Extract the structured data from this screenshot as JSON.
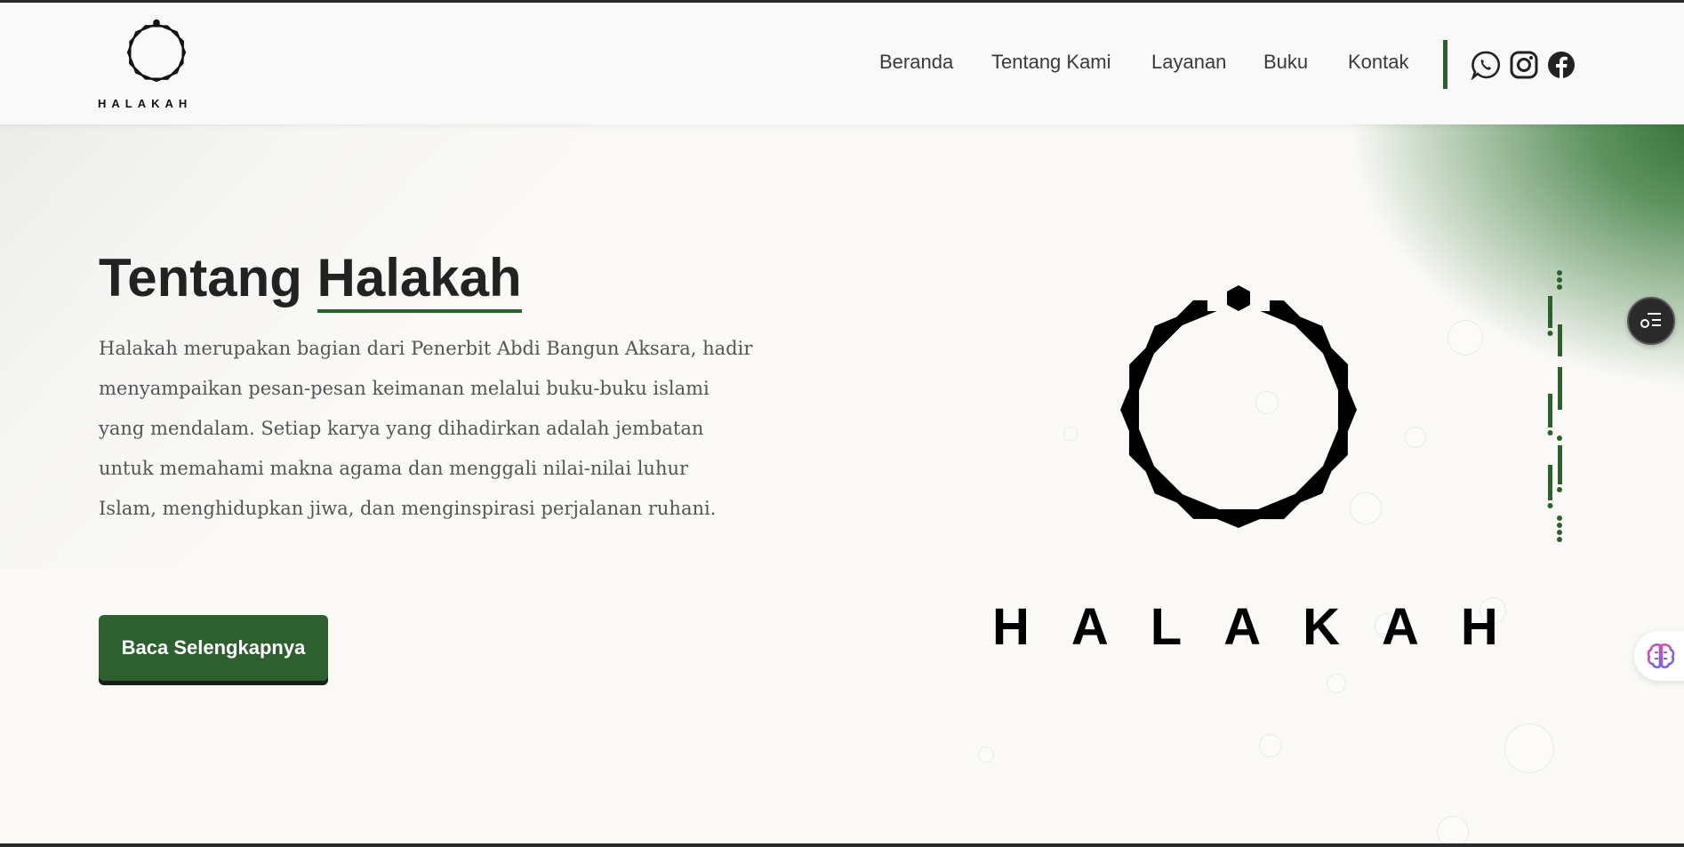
{
  "brand": {
    "name": "HALAKAH",
    "icon": "halakah-logo"
  },
  "nav": {
    "items": [
      {
        "label": "Beranda"
      },
      {
        "label": "Tentang Kami"
      },
      {
        "label": "Layanan"
      },
      {
        "label": "Buku"
      },
      {
        "label": "Kontak"
      }
    ],
    "social": [
      {
        "icon": "whatsapp-icon"
      },
      {
        "icon": "instagram-icon"
      },
      {
        "icon": "facebook-icon"
      }
    ]
  },
  "about": {
    "title_prefix": "Tentang",
    "title_highlight": "Halakah",
    "description_lines": [
      "Halakah merupakan bagian dari Penerbit Abdi Bangun Aksara, hadir",
      "menyampaikan pesan-pesan keimanan melalui buku-buku islami",
      "yang mendalam. Setiap karya yang dihadirkan adalah jembatan",
      "untuk memahami makna agama dan menggali nilai-nilai luhur",
      "Islam, menghidupkan jiwa, dan menginspirasi perjalanan ruhani."
    ],
    "button_label": "Baca Selengkapnya"
  },
  "hero": {
    "wordmark": "HALAKAH"
  },
  "colors": {
    "accent": "#2e5f2e",
    "text": "#222222",
    "background": "#faf9f6"
  },
  "widgets": {
    "toc_icon": "table-of-contents-icon",
    "assistant_icon": "brain-icon"
  }
}
